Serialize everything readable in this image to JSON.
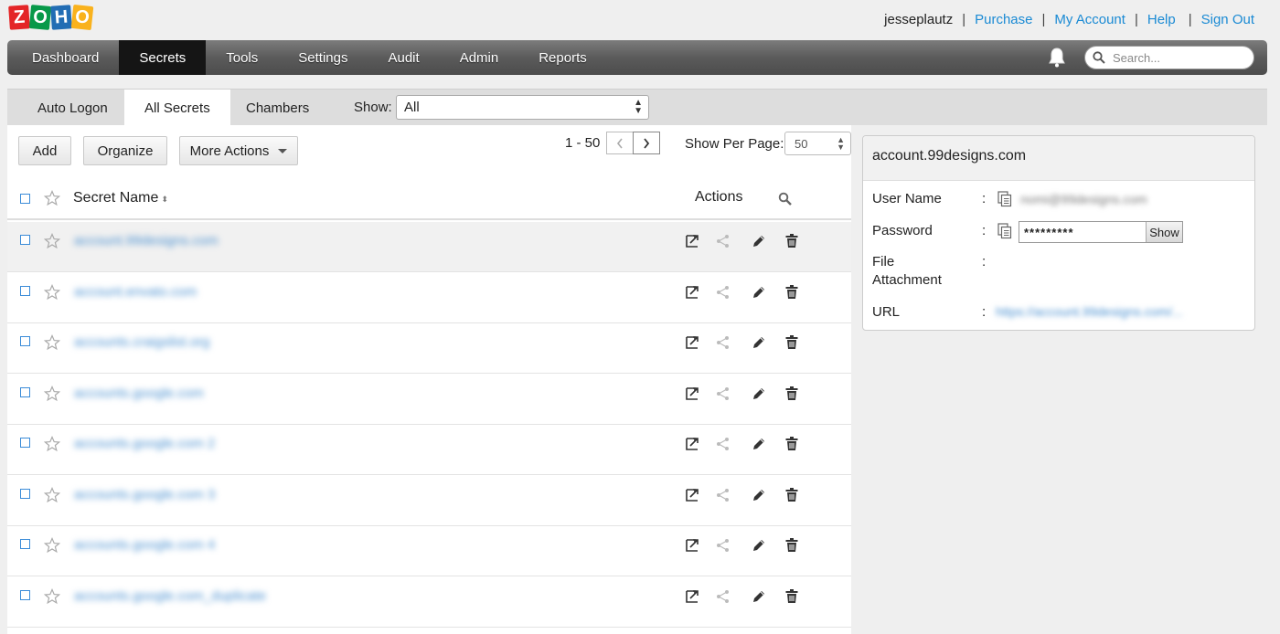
{
  "logo": {
    "letters": [
      "Z",
      "O",
      "H",
      "O"
    ],
    "colors": [
      "#e42527",
      "#089949",
      "#226db4",
      "#f9b21d"
    ]
  },
  "userbar": {
    "username": "jesseplautz",
    "links": {
      "purchase": "Purchase",
      "my_account": "My Account",
      "help": "Help",
      "sign_out": "Sign Out"
    },
    "separator": "|"
  },
  "nav": {
    "items": [
      "Dashboard",
      "Secrets",
      "Tools",
      "Settings",
      "Audit",
      "Admin",
      "Reports"
    ],
    "active": "Secrets",
    "notification_icon": "bell-icon",
    "search": {
      "placeholder": "Search...",
      "value": ""
    }
  },
  "tabs": {
    "items": [
      "Auto Logon",
      "All Secrets",
      "Chambers"
    ],
    "active": "All Secrets"
  },
  "filter": {
    "label": "Show:",
    "value": "All"
  },
  "toolbar": {
    "add": "Add",
    "organize": "Organize",
    "more_actions": "More Actions"
  },
  "pagination": {
    "range": "1 - 50",
    "per_page_label": "Show Per Page:",
    "per_page": "50"
  },
  "table": {
    "headers": {
      "name": "Secret Name",
      "actions": "Actions"
    },
    "rows": [
      {
        "name": "account.99designs.com",
        "selected": true
      },
      {
        "name": "account.envato.com",
        "selected": false
      },
      {
        "name": "accounts.craigslist.org",
        "selected": false
      },
      {
        "name": "accounts.google.com",
        "selected": false
      },
      {
        "name": "accounts.google.com 2",
        "selected": false
      },
      {
        "name": "accounts.google.com 3",
        "selected": false
      },
      {
        "name": "accounts.google.com 4",
        "selected": false
      },
      {
        "name": "accounts.google.com_duplicate",
        "selected": false
      }
    ],
    "row_action_icons": [
      "auto-logon-icon",
      "share-icon",
      "edit-icon",
      "delete-icon"
    ]
  },
  "details": {
    "title": "account.99designs.com",
    "fields": {
      "username_label": "User Name",
      "username_value": "nomi@99designs.com",
      "password_label": "Password",
      "password_value": "*********",
      "show_button": "Show",
      "file_label_1": "File",
      "file_label_2": "Attachment",
      "url_label": "URL",
      "url_value": "https://account.99designs.com/..."
    },
    "colon": ":"
  },
  "colors": {
    "link": "#1a8ad4",
    "checkbox": "#3a8bd8",
    "nav_active": "#151515"
  }
}
